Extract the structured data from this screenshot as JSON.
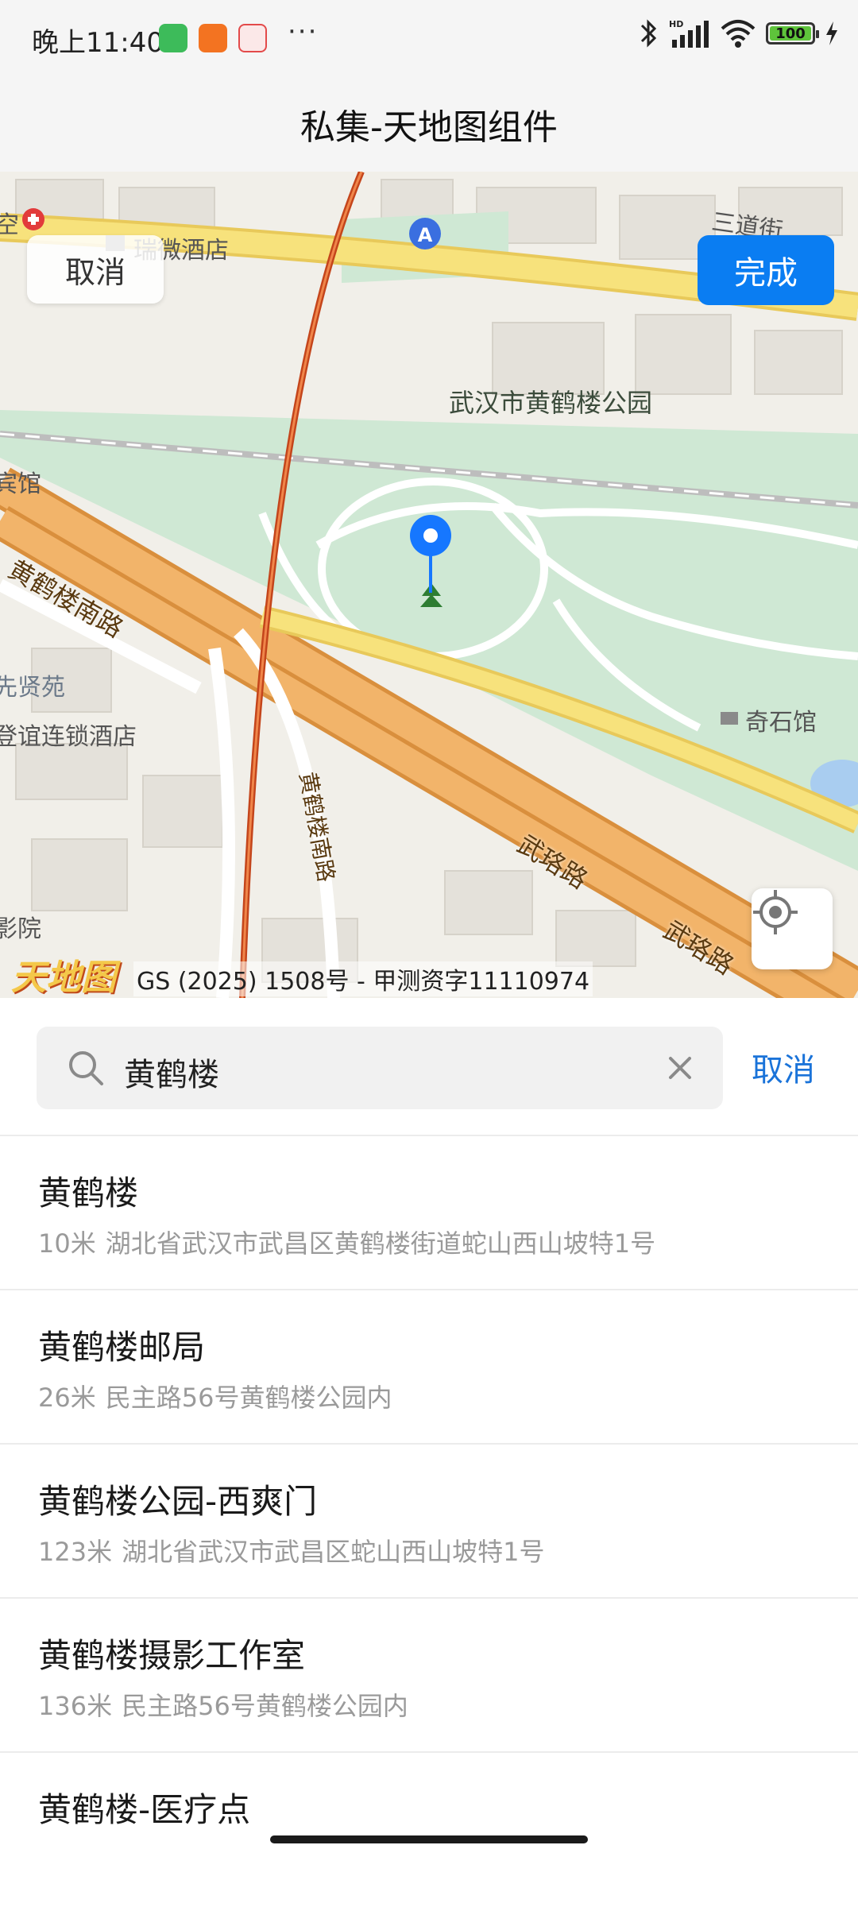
{
  "status_bar": {
    "time": "晚上11:40",
    "more": "···",
    "battery": "100"
  },
  "header": {
    "title": "私集-天地图组件"
  },
  "map": {
    "cancel_label": "取消",
    "done_label": "完成",
    "copyright": "GS (2025) 1508号 - 甲测资字11110974",
    "logo_text": "天地图",
    "labels": {
      "poi_main": "武汉市黄鹤楼公园",
      "poi_hotel1": "瑞微酒店",
      "poi_museum": "奇石馆",
      "street_top": "三道街",
      "area_xianxian": "先贤苑",
      "poi_hotel2": "登谊连锁酒店",
      "poi_binguan": "宾馆",
      "poi_cinema": "影院",
      "poi_hospital": "空",
      "road1": "黄鹤楼南路",
      "road2": "黄鹤楼南路",
      "road3": "武珞路",
      "road4": "武珞路"
    }
  },
  "search": {
    "value": "黄鹤楼",
    "cancel_label": "取消"
  },
  "results": [
    {
      "name": "黄鹤楼",
      "distance": "10米",
      "address": "湖北省武汉市武昌区黄鹤楼街道蛇山西山坡特1号"
    },
    {
      "name": "黄鹤楼邮局",
      "distance": "26米",
      "address": "民主路56号黄鹤楼公园内"
    },
    {
      "name": "黄鹤楼公园-西爽门",
      "distance": "123米",
      "address": "湖北省武汉市武昌区蛇山西山坡特1号"
    },
    {
      "name": "黄鹤楼摄影工作室",
      "distance": "136米",
      "address": "民主路56号黄鹤楼公园内"
    },
    {
      "name": "黄鹤楼-医疗点",
      "distance": "",
      "address": ""
    }
  ],
  "colors": {
    "accent": "#0a7df2",
    "link": "#1a73d9",
    "park_green": "#cfe8d4",
    "road_orange": "#f2b46a",
    "road_yellow": "#f7e27c",
    "marker_blue": "#1677ff"
  },
  "icons": {
    "search": "search-icon",
    "clear": "close-icon",
    "locate": "locate-icon",
    "marker": "map-pin-icon",
    "bluetooth": "bluetooth-icon",
    "wifi": "wifi-icon",
    "signal": "signal-icon",
    "charging": "charging-icon"
  }
}
